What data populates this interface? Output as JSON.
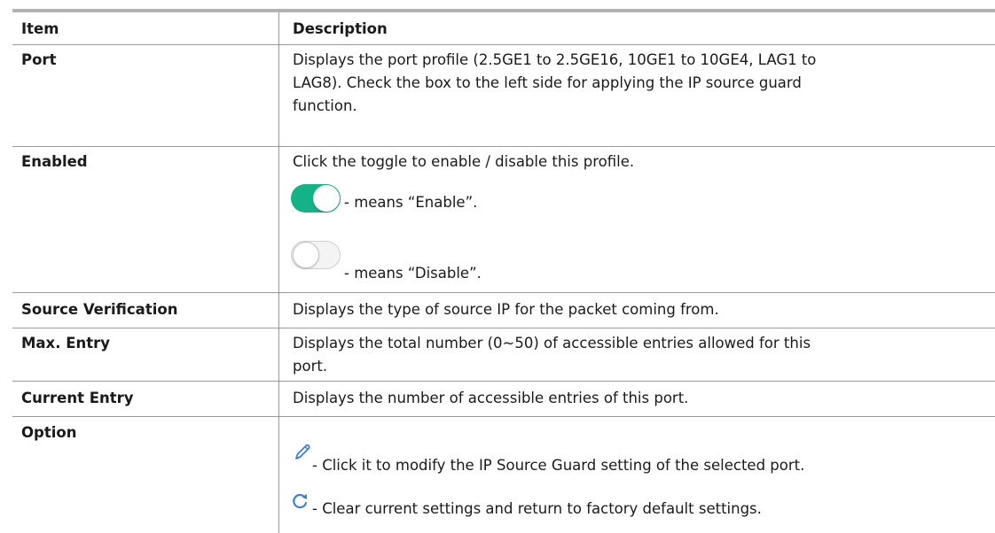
{
  "table": {
    "header": {
      "item": "Item",
      "description": "Description"
    },
    "rows": [
      {
        "item": "Port",
        "lines": [
          "Displays the port profile (2.5GE1 to 2.5GE16, 10GE1 to 10GE4, LAG1 to",
          "LAG8). Check the box to the left side for applying the IP source guard",
          "function."
        ]
      },
      {
        "item": "Enabled",
        "line1": "Click the toggle to enable / disable this profile.",
        "enable_text": "- means “Enable”.",
        "disable_text": "- means “Disable”."
      },
      {
        "item": "Source Verification",
        "lines": [
          "Displays the type of source IP for the packet coming from."
        ]
      },
      {
        "item": "Max. Entry",
        "lines": [
          "Displays the total number (0~50) of accessible entries allowed for this",
          "port."
        ]
      },
      {
        "item": "Current Entry",
        "lines": [
          "Displays the number of accessible entries of this port."
        ]
      },
      {
        "item": "Option",
        "edit_text": "- Click it to modify the IP Source Guard setting of the selected port.",
        "refresh_text": "- Clear current settings and return to factory default settings."
      }
    ]
  },
  "colors": {
    "toggle_on": "#14b385",
    "icon_blue": "#3b82d6",
    "border": "#9a9a9a"
  },
  "icons": {
    "toggle_on": "toggle-on-icon",
    "toggle_off": "toggle-off-icon",
    "edit": "pencil-icon",
    "refresh": "refresh-icon"
  }
}
